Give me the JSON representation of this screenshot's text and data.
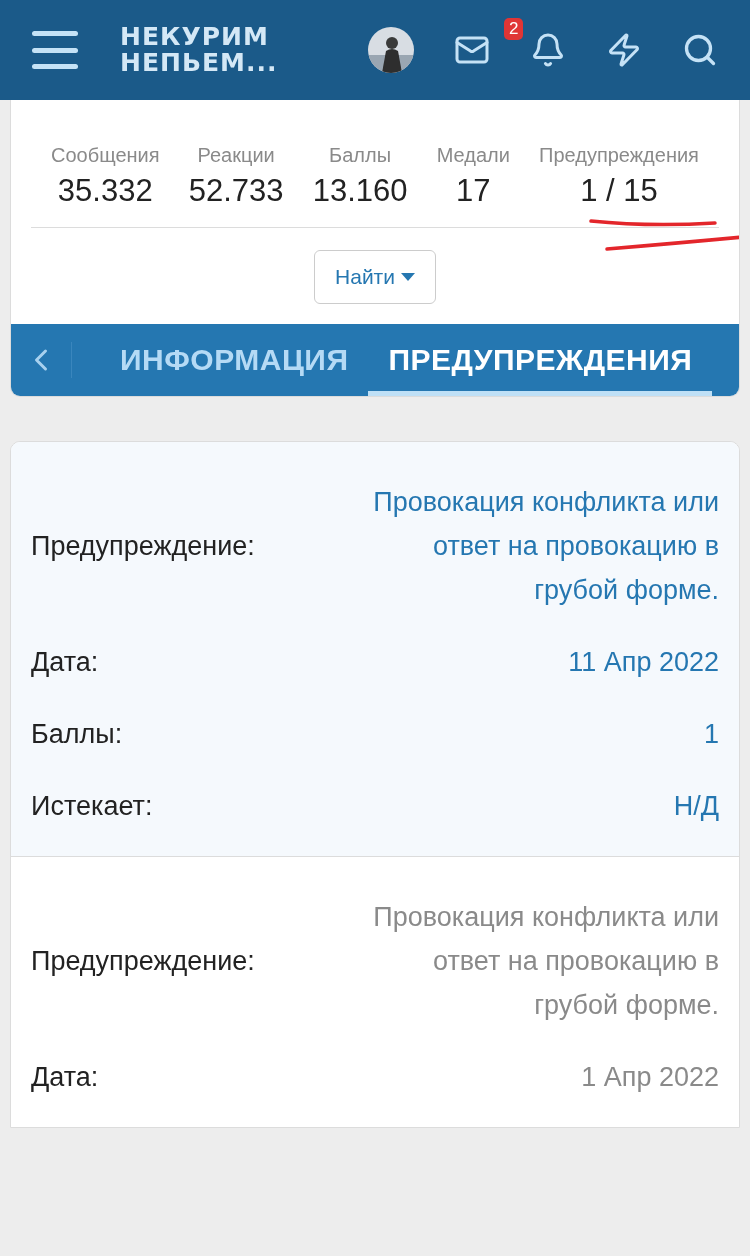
{
  "header": {
    "logo_lines": [
      "НЕКУРИМ",
      "НЕПЬЕМ..."
    ],
    "notifications_badge": "2"
  },
  "stats": [
    {
      "label": "Сообщения",
      "value": "35.332"
    },
    {
      "label": "Реакции",
      "value": "52.733"
    },
    {
      "label": "Баллы",
      "value": "13.160"
    },
    {
      "label": "Медали",
      "value": "17"
    },
    {
      "label": "Предупреждения",
      "value": "1 / 15"
    }
  ],
  "find_button": "Найти",
  "tabs": [
    {
      "label": "ИНФОРМАЦИЯ",
      "selected": false
    },
    {
      "label": "ПРЕДУПРЕЖДЕНИЯ",
      "selected": true
    }
  ],
  "warnings": [
    {
      "active": true,
      "fields": [
        {
          "label": "Предупреждение:",
          "value": "Провокация конфликта или ответ на провокацию в грубой форме."
        },
        {
          "label": "Дата:",
          "value": "11 Апр 2022"
        },
        {
          "label": "Баллы:",
          "value": "1"
        },
        {
          "label": "Истекает:",
          "value": "Н/Д"
        }
      ]
    },
    {
      "active": false,
      "fields": [
        {
          "label": "Предупреждение:",
          "value": "Провокация конфликта или ответ на провокацию в грубой форме."
        },
        {
          "label": "Дата:",
          "value": "1 Апр 2022"
        }
      ]
    }
  ]
}
